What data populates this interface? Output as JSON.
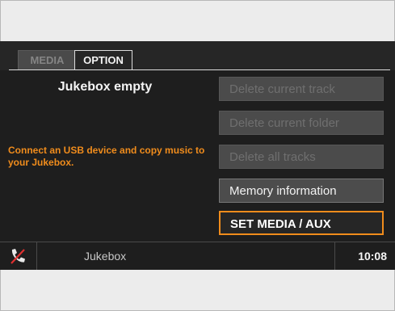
{
  "tabs": [
    {
      "label": "MEDIA"
    },
    {
      "label": "OPTION"
    }
  ],
  "main": {
    "title": "Jukebox empty",
    "message": "Connect an USB device and copy music to your Jukebox."
  },
  "options": [
    {
      "label": "Delete current track",
      "state": "disabled"
    },
    {
      "label": "Delete current folder",
      "state": "disabled"
    },
    {
      "label": "Delete all tracks",
      "state": "disabled"
    },
    {
      "label": "Memory information",
      "state": "enabled"
    },
    {
      "label": "SET MEDIA / AUX",
      "state": "selected"
    }
  ],
  "status": {
    "source": "Jukebox",
    "time": "10:08",
    "icon": "phone-icon"
  },
  "colors": {
    "accent": "#f08c1c",
    "background": "#1e1e1e"
  }
}
